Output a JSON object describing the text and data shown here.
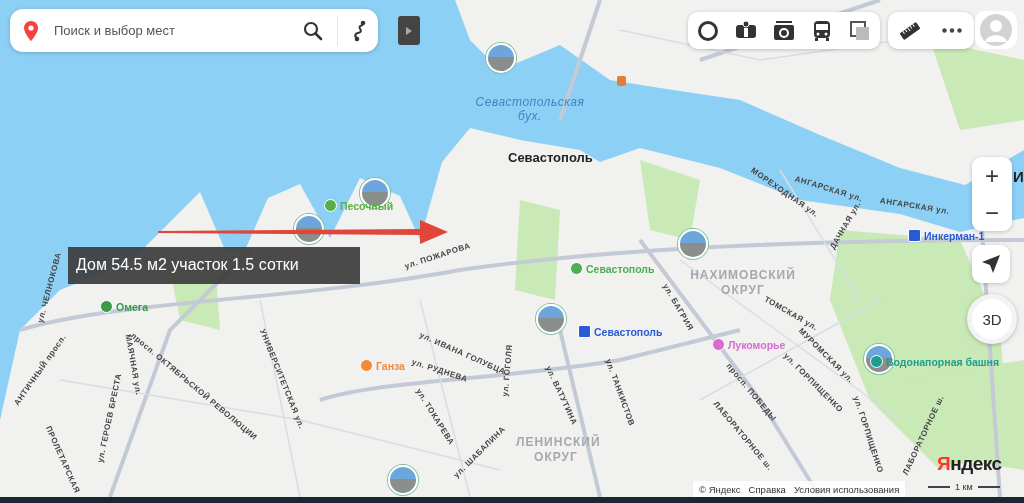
{
  "search": {
    "placeholder": "Поиск и выбор мест"
  },
  "annotation": {
    "text": "Дом 54.5 м2 участок 1.5 сотки"
  },
  "map_labels": [
    {
      "text": "Севастопольская бух.",
      "kind": "water"
    },
    {
      "text": "Севастополь",
      "kind": "city"
    },
    {
      "text": "И",
      "kind": "city"
    },
    {
      "text": "Песочный",
      "kind": "poi",
      "color": "#5aae4a"
    },
    {
      "text": "Инкерман-1",
      "kind": "station",
      "color": "#2a5bd7"
    },
    {
      "text": "Севастополь",
      "kind": "poi",
      "color": "#4caf50"
    },
    {
      "text": "НАХИМОВСКИЙ ОКРУГ",
      "kind": "district"
    },
    {
      "text": "Омега",
      "kind": "poi",
      "color": "#3a9a4a"
    },
    {
      "text": "Севастополь",
      "kind": "station",
      "color": "#2a5bd7"
    },
    {
      "text": "Лукоморье",
      "kind": "poi",
      "color": "#d66bd0"
    },
    {
      "text": "Ганза",
      "kind": "poi",
      "color": "#f08a3c"
    },
    {
      "text": "Водонапорная башня",
      "kind": "poi",
      "color": "#1f9e8e"
    },
    {
      "text": "ЛЕНИНСКИЙ ОКРУГ",
      "kind": "district"
    },
    {
      "text": "ул. ПОЖАРОВА",
      "kind": "street"
    },
    {
      "text": "ул. ИВАНА ГОЛУБЦА",
      "kind": "street"
    },
    {
      "text": "ул. РУДНЕВА",
      "kind": "street"
    },
    {
      "text": "ул. ТОКАРЕВА",
      "kind": "street"
    },
    {
      "text": "ул. ШАБАЛИНА",
      "kind": "street"
    },
    {
      "text": "просп. ОКТЯБРЬСКОЙ РЕВОЛЮЦИИ",
      "kind": "street"
    },
    {
      "text": "УНИВЕРСИТЕТСКАЯ ул.",
      "kind": "street"
    },
    {
      "text": "МАЯЧНАЯ ул.",
      "kind": "street"
    },
    {
      "text": "ул. ГЕРОЕВ БРЕСТА",
      "kind": "street"
    },
    {
      "text": "АНТИЧНЫЙ просп.",
      "kind": "street"
    },
    {
      "text": "ПРОЛЕТАРСКАЯ",
      "kind": "street"
    },
    {
      "text": "ул. ЧЕЛНОКОВА",
      "kind": "street"
    },
    {
      "text": "МОРЕХОДНАЯ ул.",
      "kind": "street"
    },
    {
      "text": "АНГАРСКАЯ ул.",
      "kind": "street"
    },
    {
      "text": "АНГАРСКАЯ ул.",
      "kind": "street"
    },
    {
      "text": "ДАЧНАЯ ул.",
      "kind": "street"
    },
    {
      "text": "ул. БАГРИЯ",
      "kind": "street"
    },
    {
      "text": "ТОМСКАЯ ул.",
      "kind": "street"
    },
    {
      "text": "МУРОМСКАЯ ул.",
      "kind": "street"
    },
    {
      "text": "ул. ГОРПИЩЕНКО",
      "kind": "street"
    },
    {
      "text": "просп. ПОБЕДЫ",
      "kind": "street"
    },
    {
      "text": "ЛАБОРАТОРНОЕ ш.",
      "kind": "street"
    },
    {
      "text": "ЛАБОРАТОРНОЕ ш.",
      "kind": "street"
    },
    {
      "text": "ул. ГОРПИЩЕНКО",
      "kind": "street"
    },
    {
      "text": "ул. ТАНКИСТОВ",
      "kind": "street"
    },
    {
      "text": "ул. ВАТУТИНА",
      "kind": "street"
    },
    {
      "text": "ул. ГОГОЛЯ",
      "kind": "street"
    }
  ],
  "zoom_controls": {
    "plus": "+",
    "minus": "−"
  },
  "compass": {
    "label": "3D"
  },
  "logo": "Яндекс",
  "footer": {
    "links": [
      "© Яндекс",
      "Справка",
      "Условия использования"
    ],
    "scale": "1 км"
  }
}
